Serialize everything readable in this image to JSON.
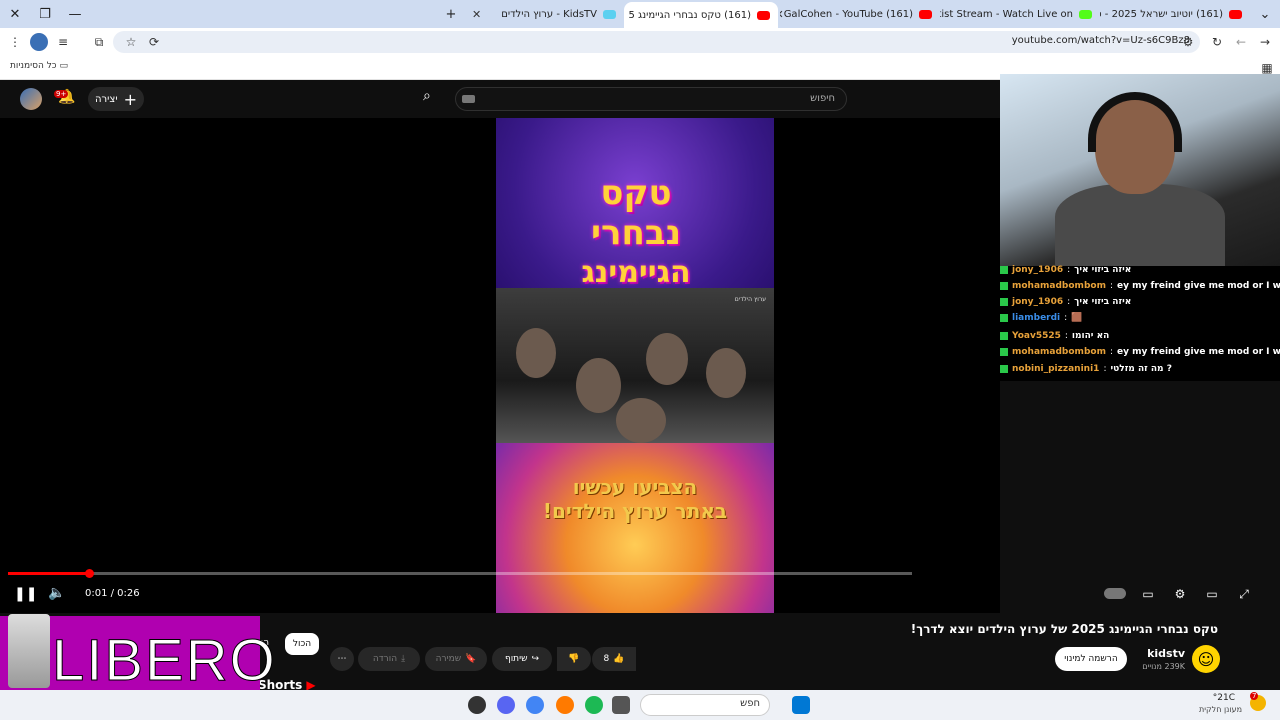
{
  "browser": {
    "tabs": [
      {
        "label": "KidsTV - ערוץ הילדים",
        "active": false
      },
      {
        "label": "(161) טקס נבחרי הגיימינג 5",
        "active": true
      },
      {
        "label": "(161) GalCohen - YouTube",
        "active": false
      },
      {
        "label": "Shotist Stream - Watch Live on",
        "active": false
      },
      {
        "label": "(161) יוטיוב ישראל 2025 - סרט",
        "active": false
      }
    ],
    "url": "youtube.com/watch?v=Uz-s6C9Bz8",
    "bookmarks_all": "כל הסימניות"
  },
  "youtube": {
    "search_placeholder": "חיפוש",
    "create_label": "יצירה",
    "notification_count": "9+",
    "player": {
      "time": "0:01 / 0:26",
      "progress_fraction": 0.09
    },
    "video": {
      "logo_line1": "טקס",
      "logo_line2": "נבחרי",
      "logo_line3": "הגיימינג",
      "cta_line1": "הצביעו עכשיו",
      "cta_line2": "באתר ערוץ הילדים!",
      "watermark": "ערוץ הילדים"
    },
    "title": "טקס נבחרי הגיימינג 2025 של ערוץ הילדים יוצא לדרך!",
    "channel": {
      "name": "kidstv",
      "subs": "239K מנויים",
      "subscribe": "הרשמה למינוי"
    },
    "actions": {
      "likes": "8",
      "share": "שיתוף",
      "save": "שמירה",
      "download": "הורדה"
    },
    "chips": {
      "all": "הכול",
      "second": "הוע"
    },
    "shorts": "Shorts"
  },
  "chat": [
    {
      "user": "jony_1906",
      "color": "#e8a23a",
      "message": "איזה ביזוי איך"
    },
    {
      "user": "mohamadbombom",
      "color": "#e8a23a",
      "message": "ey my freind give me mod or I will blow up"
    },
    {
      "user": "jony_1906",
      "color": "#e8a23a",
      "message": "איזה ביזוי איך"
    },
    {
      "user": "liamberdi",
      "color": "#3a8de8",
      "message": "🟫"
    },
    {
      "user": "Yoav5525",
      "color": "#e8a23a",
      "message": "הא יהומו"
    },
    {
      "user": "mohamadbombom",
      "color": "#e8a23a",
      "message": "ey my freind give me mod or I will blow up"
    },
    {
      "user": "nobini_pizzanini1",
      "color": "#e8a23a",
      "message": "מה זה מזלטי ?"
    }
  ],
  "ad": {
    "text": "LIBERO"
  },
  "taskbar": {
    "search_label": "חפש",
    "weather_temp": "°21C",
    "weather_desc": "מעונן חלקית",
    "badge": "7"
  },
  "colors": {
    "yt_bg": "#0f0f0f",
    "progress_red": "#ff0000",
    "chrome_titlebar": "#cfdcf1",
    "ad_purple": "#b000b0"
  }
}
